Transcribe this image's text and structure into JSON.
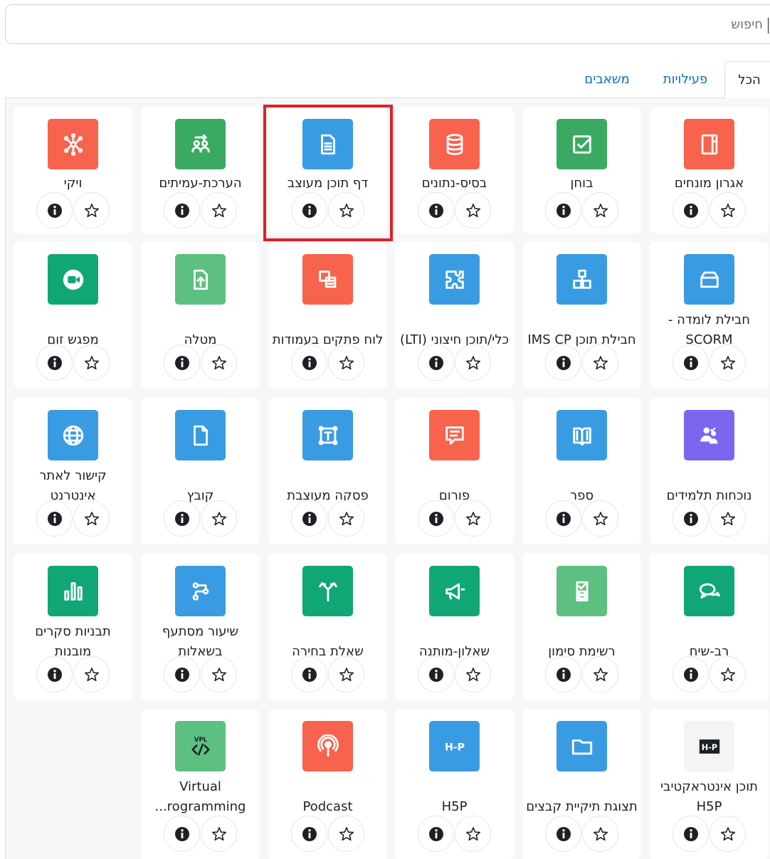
{
  "search": {
    "value": "חיפוש"
  },
  "tabs": [
    {
      "label": "הכל",
      "active": true
    },
    {
      "label": "פעילויות",
      "active": false
    },
    {
      "label": "משאבים",
      "active": false
    }
  ],
  "colors": {
    "red": "#f7634d",
    "green": "#3aaa62",
    "lightgreen": "#5dbf80",
    "blue": "#399be2",
    "purple": "#7b66f0",
    "teal": "#11a676",
    "podcast": "#f7634d",
    "tab_link": "#0f6cbf",
    "highlight": "#e41e23"
  },
  "modules": [
    {
      "label": "אגרון מונחים",
      "icon": "glossary-icon",
      "color": "#f7634d"
    },
    {
      "label": "בוחן",
      "icon": "quiz-icon",
      "color": "#3aaa62"
    },
    {
      "label": "בסיס-נתונים",
      "icon": "database-icon",
      "color": "#f7634d"
    },
    {
      "label": "דף תוכן מעוצב",
      "icon": "page-icon",
      "color": "#399be2",
      "highlighted": true
    },
    {
      "label": "הערכת-עמיתים",
      "icon": "workshop-icon",
      "color": "#3aaa62"
    },
    {
      "label": "ויקי",
      "icon": "wiki-icon",
      "color": "#f7634d"
    },
    {
      "label": "חבילת לומדה - SCORM",
      "icon": "scorm-icon",
      "color": "#399be2"
    },
    {
      "label": "חבילת תוכן IMS CP",
      "icon": "imscp-icon",
      "color": "#399be2"
    },
    {
      "label": "כלי/תוכן חיצוני (LTI)",
      "icon": "lti-icon",
      "color": "#399be2"
    },
    {
      "label": "לוח פתקים בעמודות",
      "icon": "board-icon",
      "color": "#f7634d"
    },
    {
      "label": "מטלה",
      "icon": "assignment-icon",
      "color": "#5dbf80"
    },
    {
      "label": "מפגש זום",
      "icon": "zoom-icon",
      "color": "#11a676"
    },
    {
      "label": "נוכחות תלמידים",
      "icon": "attendance-icon",
      "color": "#7b66f0"
    },
    {
      "label": "ספר",
      "icon": "book-icon",
      "color": "#399be2"
    },
    {
      "label": "פורום",
      "icon": "forum-icon",
      "color": "#f7634d"
    },
    {
      "label": "פסקה מעוצבת",
      "icon": "text-area-icon",
      "color": "#399be2"
    },
    {
      "label": "קובץ",
      "icon": "file-icon",
      "color": "#399be2"
    },
    {
      "label": "קישור לאתר אינטרנט",
      "icon": "url-icon",
      "color": "#399be2"
    },
    {
      "label": "רב-שיח",
      "icon": "chat-icon",
      "color": "#11a676"
    },
    {
      "label": "רשימת סימון",
      "icon": "checklist-icon",
      "color": "#5dbf80"
    },
    {
      "label": "שאלון-מותנה",
      "icon": "feedback-icon",
      "color": "#11a676"
    },
    {
      "label": "שאלת בחירה",
      "icon": "choice-icon",
      "color": "#11a676"
    },
    {
      "label": "שיעור מסתעף בשאלות",
      "icon": "lesson-icon",
      "color": "#399be2"
    },
    {
      "label": "תבניות סקרים מובנות",
      "icon": "survey-icon",
      "color": "#11a676"
    },
    {
      "label": "תוכן אינטראקטיבי H5P",
      "icon": "h5p-dark-icon",
      "color": "#f3f4f5"
    },
    {
      "label": "תצוגת תיקיית קבצים",
      "icon": "folder-icon",
      "color": "#399be2"
    },
    {
      "label": "H5P",
      "icon": "h5p-icon",
      "color": "#399be2"
    },
    {
      "label": "Podcast",
      "icon": "podcast-icon",
      "color": "#f7634d"
    },
    {
      "label": "Virtual ...rogramming",
      "icon": "vpl-icon",
      "color": "#5dbf80"
    }
  ]
}
